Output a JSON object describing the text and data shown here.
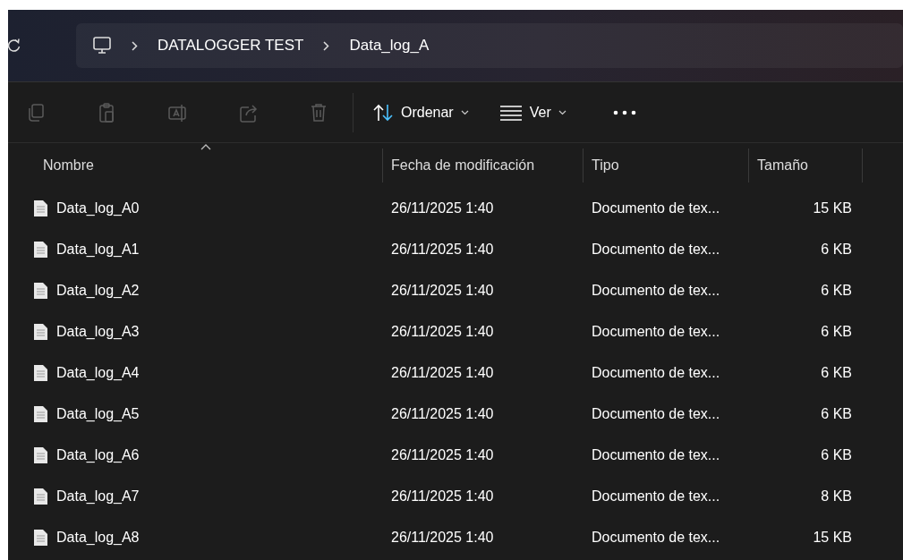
{
  "address_bar": {
    "breadcrumbs": [
      {
        "kind": "computer"
      },
      {
        "kind": "folder",
        "label": "DATALOGGER TEST"
      },
      {
        "kind": "folder",
        "label": "Data_log_A"
      }
    ]
  },
  "toolbar": {
    "actions": [
      {
        "kind": "copy",
        "disabled": true
      },
      {
        "kind": "paste",
        "disabled": true
      },
      {
        "kind": "rename",
        "disabled": true
      },
      {
        "kind": "share",
        "disabled": true
      },
      {
        "kind": "delete",
        "disabled": true
      }
    ],
    "menus": [
      {
        "kind": "sort",
        "label": "Ordenar"
      },
      {
        "kind": "view",
        "label": "Ver"
      }
    ]
  },
  "table": {
    "columns": [
      {
        "label": "Nombre",
        "sorted": true
      },
      {
        "label": "Fecha de modificación",
        "sorted": false
      },
      {
        "label": "Tipo",
        "sorted": false
      },
      {
        "label": "Tamaño",
        "sorted": false
      }
    ],
    "rows": [
      {
        "name": "Data_log_A0",
        "date": "26/11/2025 1:40",
        "type": "Documento de tex...",
        "size": "15 KB"
      },
      {
        "name": "Data_log_A1",
        "date": "26/11/2025 1:40",
        "type": "Documento de tex...",
        "size": "6 KB"
      },
      {
        "name": "Data_log_A2",
        "date": "26/11/2025 1:40",
        "type": "Documento de tex...",
        "size": "6 KB"
      },
      {
        "name": "Data_log_A3",
        "date": "26/11/2025 1:40",
        "type": "Documento de tex...",
        "size": "6 KB"
      },
      {
        "name": "Data_log_A4",
        "date": "26/11/2025 1:40",
        "type": "Documento de tex...",
        "size": "6 KB"
      },
      {
        "name": "Data_log_A5",
        "date": "26/11/2025 1:40",
        "type": "Documento de tex...",
        "size": "6 KB"
      },
      {
        "name": "Data_log_A6",
        "date": "26/11/2025 1:40",
        "type": "Documento de tex...",
        "size": "6 KB"
      },
      {
        "name": "Data_log_A7",
        "date": "26/11/2025 1:40",
        "type": "Documento de tex...",
        "size": "8 KB"
      },
      {
        "name": "Data_log_A8",
        "date": "26/11/2025 1:40",
        "type": "Documento de tex...",
        "size": "15 KB"
      }
    ]
  }
}
